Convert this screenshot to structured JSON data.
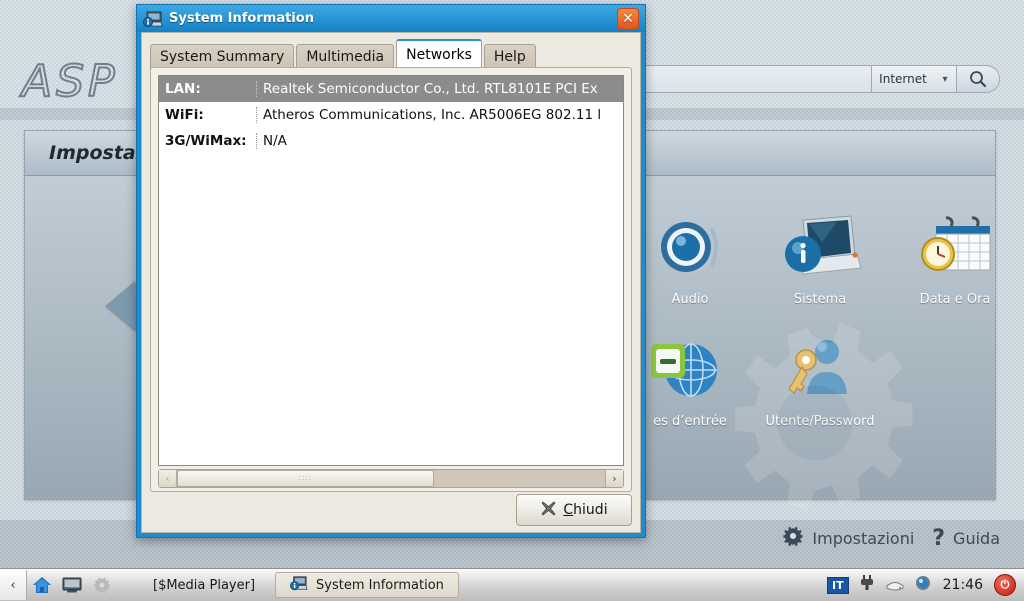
{
  "desktop": {
    "logo": "ASP",
    "search": {
      "value": "",
      "scope": "Internet",
      "go_icon": "search-icon",
      "caret_icon": "chevron-down-icon"
    },
    "panel": {
      "title": "Impostaz",
      "prev_icon": "previous-arrow-icon",
      "icons": [
        {
          "label": "Audio",
          "icon": "speaker-icon"
        },
        {
          "label": "Sistema",
          "icon": "laptop-info-icon"
        },
        {
          "label": "Data e Ora",
          "icon": "calendar-clock-icon"
        },
        {
          "label": "es d’entrée",
          "icon": "globe-network-icon"
        },
        {
          "label": "Utente/Password",
          "icon": "user-key-icon"
        }
      ]
    },
    "links": [
      {
        "label": "Impostazioni",
        "icon": "gear-icon"
      },
      {
        "label": "Guida",
        "icon": "question-mark-icon"
      }
    ]
  },
  "window": {
    "title": "System Information",
    "icon": "system-information-icon",
    "close_label": "✕",
    "tabs": [
      {
        "label": "System Summary",
        "active": false
      },
      {
        "label": "Multimedia",
        "active": false
      },
      {
        "label": "Networks",
        "active": true
      },
      {
        "label": "Help",
        "active": false
      }
    ],
    "rows": [
      {
        "key": "LAN:",
        "value": "Realtek Semiconductor Co., Ltd. RTL8101E PCI Ex",
        "selected": true
      },
      {
        "key": "WiFi:",
        "value": "Atheros Communications, Inc. AR5006EG 802.11 l",
        "selected": false
      },
      {
        "key": "3G/WiMax:",
        "value": "N/A",
        "selected": false
      }
    ],
    "scrollbar": {
      "left_icon": "‹",
      "right_icon": "›",
      "grip": "∷∷"
    },
    "close_button": {
      "prefix": "",
      "accel": "C",
      "rest": "hiudi",
      "icon": "cancel-x-icon"
    }
  },
  "taskbar": {
    "back_icon": "‹",
    "launchers": [
      {
        "icon": "home-icon"
      },
      {
        "icon": "display-icon"
      },
      {
        "icon": "gear-icon"
      }
    ],
    "tasks": [
      {
        "label": "[$Media Player]",
        "active": false,
        "icon": ""
      },
      {
        "label": "System Information",
        "active": true,
        "icon": "system-information-icon"
      }
    ],
    "tray": {
      "keyboard_layout": "IT",
      "plug_icon": "power-plug-icon",
      "disk_icon": "disk-icon",
      "network_icon": "network-status-icon",
      "clock": "21:46",
      "power_icon": "power-button-icon"
    }
  },
  "colors": {
    "titlebar_blue": "#1f8ccd",
    "accent_tab": "#2b8fd4",
    "close_orange": "#e2521d",
    "selection_gray": "#8c8c8c",
    "window_chrome": "#ece9e1"
  }
}
